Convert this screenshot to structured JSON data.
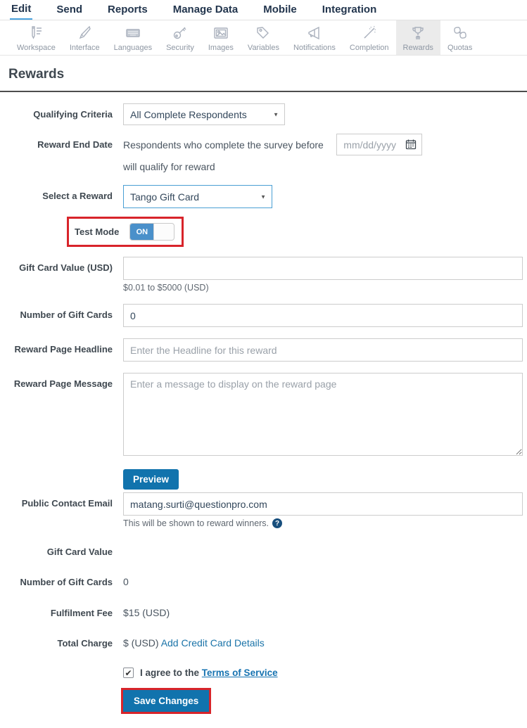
{
  "nav": {
    "items": [
      {
        "label": "Edit",
        "active": true
      },
      {
        "label": "Send",
        "active": false
      },
      {
        "label": "Reports",
        "active": false
      },
      {
        "label": "Manage Data",
        "active": false
      },
      {
        "label": "Mobile",
        "active": false
      },
      {
        "label": "Integration",
        "active": false
      }
    ]
  },
  "toolbar": {
    "items": [
      {
        "label": "Workspace",
        "icon": "workspace-icon",
        "selected": false
      },
      {
        "label": "Interface",
        "icon": "interface-icon",
        "selected": false
      },
      {
        "label": "Languages",
        "icon": "languages-icon",
        "selected": false
      },
      {
        "label": "Security",
        "icon": "security-icon",
        "selected": false
      },
      {
        "label": "Images",
        "icon": "images-icon",
        "selected": false
      },
      {
        "label": "Variables",
        "icon": "variables-icon",
        "selected": false
      },
      {
        "label": "Notifications",
        "icon": "notifications-icon",
        "selected": false
      },
      {
        "label": "Completion",
        "icon": "completion-icon",
        "selected": false
      },
      {
        "label": "Rewards",
        "icon": "rewards-icon",
        "selected": true
      },
      {
        "label": "Quotas",
        "icon": "quotas-icon",
        "selected": false
      }
    ]
  },
  "page": {
    "title": "Rewards"
  },
  "form": {
    "qualifying_criteria": {
      "label": "Qualifying Criteria",
      "value": "All Complete Respondents"
    },
    "reward_end_date": {
      "label": "Reward End Date",
      "prefix": "Respondents who complete the survey before",
      "placeholder": "mm/dd/yyyy",
      "suffix": "will qualify for reward"
    },
    "select_reward": {
      "label": "Select a Reward",
      "value": "Tango Gift Card"
    },
    "test_mode": {
      "label": "Test Mode",
      "state": "ON"
    },
    "gift_card_value": {
      "label": "Gift Card Value (USD)",
      "value": "",
      "hint": "$0.01 to $5000 (USD)"
    },
    "num_gift_cards": {
      "label": "Number of Gift Cards",
      "value": "0"
    },
    "headline": {
      "label": "Reward Page Headline",
      "placeholder": "Enter the Headline for this reward"
    },
    "message": {
      "label": "Reward Page Message",
      "placeholder": "Enter a message to display on the reward page"
    },
    "preview_button": "Preview",
    "contact_email": {
      "label": "Public Contact Email",
      "value": "matang.surti@questionpro.com",
      "hint": "This will be shown to reward winners.",
      "help_glyph": "?"
    },
    "summary": [
      {
        "label": "Gift Card Value",
        "value": ""
      },
      {
        "label": "Number of Gift Cards",
        "value": "0"
      },
      {
        "label": "Fulfilment Fee",
        "value": "$15 (USD)"
      },
      {
        "label": "Total Charge",
        "value": "$ (USD)",
        "link": "Add Credit Card Details"
      }
    ],
    "agree": {
      "check_glyph": "✔",
      "text": "I agree to the",
      "link": "Terms of Service"
    },
    "save_button": "Save Changes"
  },
  "colors": {
    "accent_blue": "#1173ad",
    "toggle_blue": "#4a90ca",
    "link_blue": "#1a73a8",
    "annotation_red": "#d8242a",
    "nav_underline": "#4aa3df",
    "selected_tab_bg": "#ebebeb"
  }
}
